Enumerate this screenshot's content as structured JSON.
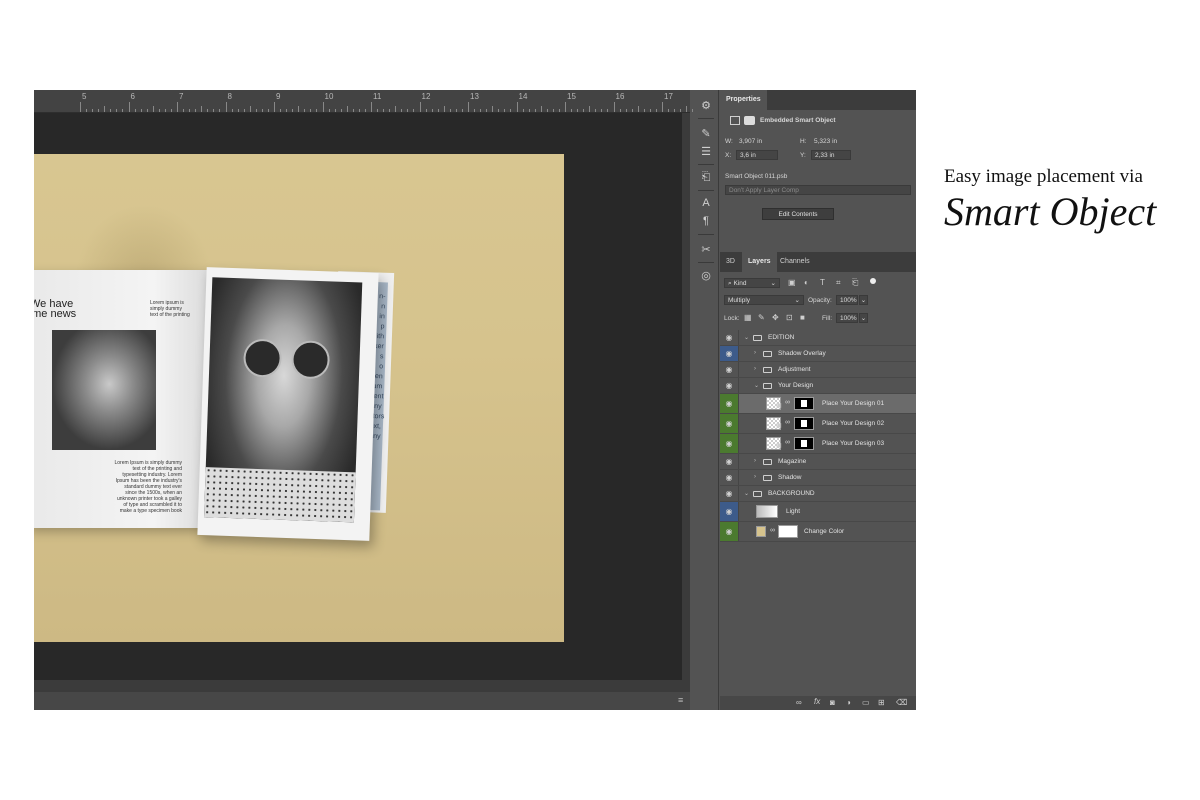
{
  "ruler": {
    "numbers": [
      "5",
      "6",
      "7",
      "8",
      "9",
      "10",
      "11",
      "12",
      "13",
      "14",
      "15",
      "16",
      "17"
    ]
  },
  "document": {
    "left_page": {
      "headline_line1": "We have",
      "headline_line2": "ome news",
      "small_caption": "Lorem ipsum is simply dummy text of the printing",
      "body": "Lorem Ipsum is simply dummy text of the printing and typesetting industry. Lorem Ipsum has been the industry's standard dummy text ever since the 1500s, when an unknown printer took a galley of type and scrambled it to make a type specimen book"
    },
    "right_page_words": [
      "n-",
      "n",
      "in",
      "p",
      "ith",
      "ker",
      "s",
      "o",
      "when",
      "sum",
      "ontent",
      "Many",
      "editors",
      "l text,",
      "many"
    ]
  },
  "properties": {
    "tab": "Properties",
    "type_label": "Embedded Smart Object",
    "w_label": "W:",
    "w_value": "3,907 in",
    "h_label": "H:",
    "h_value": "5,323 in",
    "x_label": "X:",
    "x_value": "3,6 in",
    "y_label": "Y:",
    "y_value": "2,33 in",
    "file_name": "Smart Object 011.psb",
    "layer_comp_placeholder": "Don't Apply Layer Comp",
    "edit_contents": "Edit Contents"
  },
  "layers_panel": {
    "tabs": [
      "3D",
      "Layers",
      "Channels"
    ],
    "active_tab": "Layers",
    "filter_kind": "Kind",
    "blend_mode": "Multiply",
    "opacity_label": "Opacity:",
    "opacity_value": "100%",
    "lock_label": "Lock:",
    "fill_label": "Fill:",
    "fill_value": "100%",
    "layers": [
      {
        "name": "EDITION",
        "kind": "group",
        "eye": "plain",
        "indent": 0,
        "expanded": true
      },
      {
        "name": "Shadow Overlay",
        "kind": "group",
        "eye": "blue",
        "indent": 1,
        "expanded": false
      },
      {
        "name": "Adjustment",
        "kind": "group",
        "eye": "plain",
        "indent": 1,
        "expanded": false
      },
      {
        "name": "Your Design",
        "kind": "group",
        "eye": "plain",
        "indent": 1,
        "expanded": true
      },
      {
        "name": "Place Your Design 01",
        "kind": "smart",
        "eye": "green",
        "indent": 2,
        "selected": true
      },
      {
        "name": "Place Your Design 02",
        "kind": "smart",
        "eye": "green",
        "indent": 2
      },
      {
        "name": "Place Your Design 03",
        "kind": "smart",
        "eye": "green",
        "indent": 2
      },
      {
        "name": "Magazine",
        "kind": "group",
        "eye": "plain",
        "indent": 1,
        "expanded": false
      },
      {
        "name": "Shadow",
        "kind": "group",
        "eye": "plain",
        "indent": 1,
        "expanded": false
      },
      {
        "name": "BACKGROUND",
        "kind": "group",
        "eye": "plain",
        "indent": 0,
        "expanded": true
      },
      {
        "name": "Light",
        "kind": "gradient",
        "eye": "blue",
        "indent": 1
      },
      {
        "name": "Change Color",
        "kind": "fill",
        "eye": "green",
        "indent": 1
      }
    ],
    "footer_icons": [
      "link-icon",
      "fx-icon",
      "mask-icon",
      "adjustment-icon",
      "folder-icon",
      "new-layer-icon",
      "trash-icon"
    ]
  },
  "caption": {
    "line1": "Easy image placement via",
    "line2": "Smart Object"
  },
  "colors": {
    "paper": "#d6c38d",
    "eye_green": "#4b7a2f",
    "eye_blue": "#3d5b8a",
    "panel_bg": "#535353"
  }
}
